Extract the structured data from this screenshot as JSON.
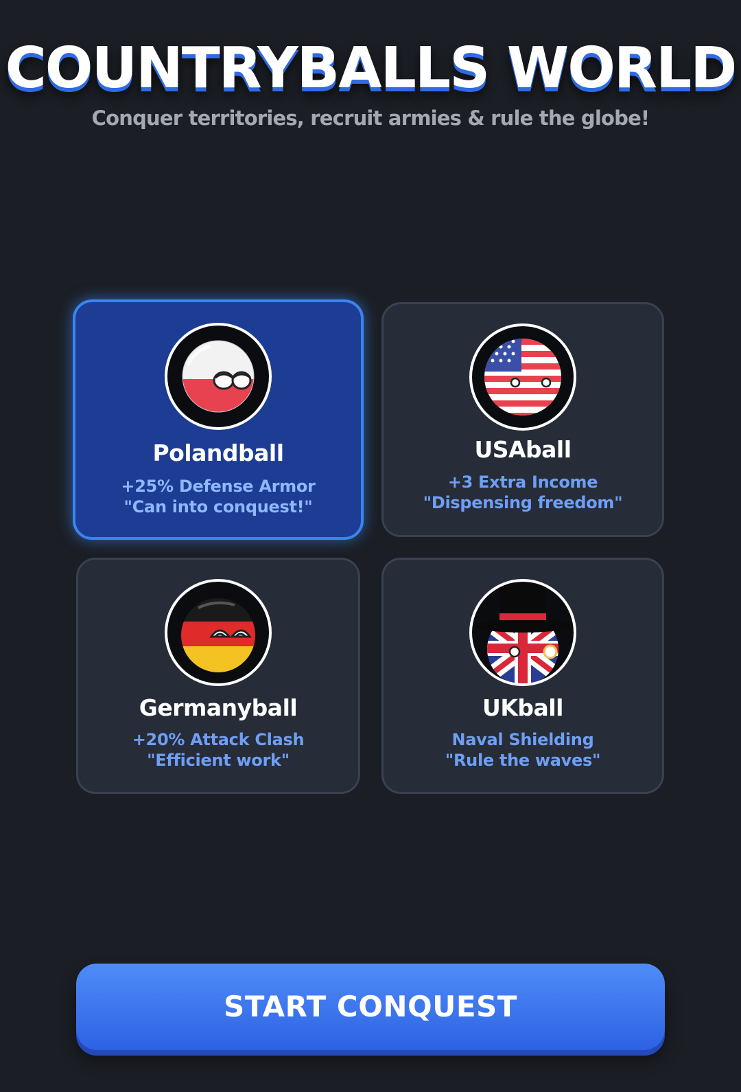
{
  "header": {
    "title": "COUNTRYBALLS WORLD",
    "subtitle": "Conquer territories, recruit armies & rule the globe!"
  },
  "countries": [
    {
      "name": "Polandball",
      "bonus": "+25% Defense Armor",
      "quote": "\"Can into conquest!\"",
      "selected": true,
      "icon": "polandball-icon"
    },
    {
      "name": "USAball",
      "bonus": "+3 Extra Income",
      "quote": "\"Dispensing freedom\"",
      "selected": false,
      "icon": "usaball-icon"
    },
    {
      "name": "Germanyball",
      "bonus": "+20% Attack Clash",
      "quote": "\"Efficient work\"",
      "selected": false,
      "icon": "germanyball-icon"
    },
    {
      "name": "UKball",
      "bonus": "Naval Shielding",
      "quote": "\"Rule the waves\"",
      "selected": false,
      "icon": "ukball-icon"
    }
  ],
  "start_button": {
    "label": "START CONQUEST"
  },
  "colors": {
    "background": "#1b1e24",
    "card": "#262c38",
    "card_selected": "#1d3c94",
    "accent": "#3b84f2",
    "subtext": "#6f9ff5"
  }
}
